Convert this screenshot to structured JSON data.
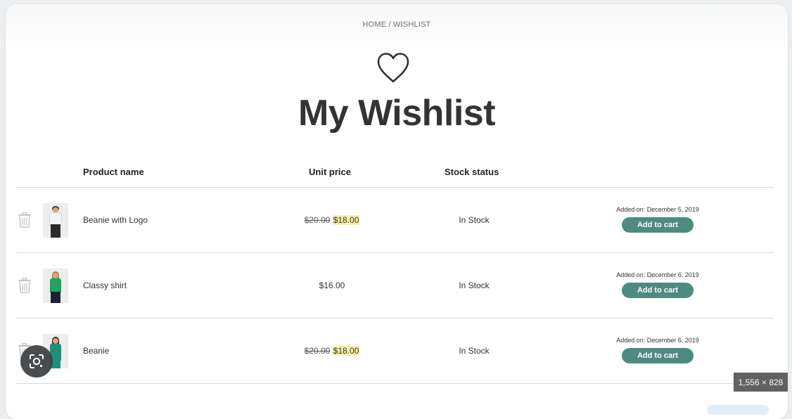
{
  "breadcrumb": "HOME / WISHLIST",
  "page_title": "My Wishlist",
  "table": {
    "headers": {
      "product_name": "Product name",
      "unit_price": "Unit price",
      "stock_status": "Stock status"
    },
    "rows": [
      {
        "name": "Beanie with Logo",
        "old_price": "$20.00",
        "sale_price": "$18.00",
        "price": "",
        "stock": "In Stock",
        "added": "Added on: December 5, 2019",
        "cart_label": "Add to cart"
      },
      {
        "name": "Classy shirt",
        "old_price": "",
        "sale_price": "",
        "price": "$16.00",
        "stock": "In Stock",
        "added": "Added on: December 6, 2019",
        "cart_label": "Add to cart"
      },
      {
        "name": "Beanie",
        "old_price": "$20.00",
        "sale_price": "$18.00",
        "price": "",
        "stock": "In Stock",
        "added": "Added on: December 6, 2019",
        "cart_label": "Add to cart"
      }
    ]
  },
  "overlay": {
    "image_dimensions": "1,556 × 828"
  },
  "icons": [
    "heart-icon",
    "trash-icon",
    "visual-search-icon"
  ],
  "colors": {
    "button": "#4f8a80",
    "sale_highlight": "#fbf0a6"
  }
}
